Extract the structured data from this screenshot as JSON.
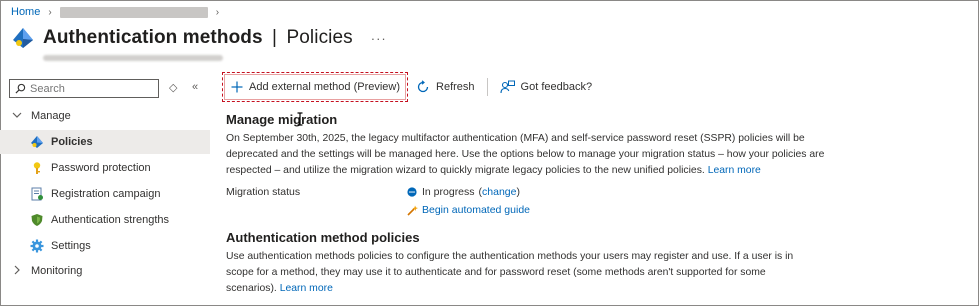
{
  "breadcrumb": {
    "home": "Home",
    "chevron": "›"
  },
  "header": {
    "title_main": "Authentication methods",
    "title_sep": "|",
    "title_sub": "Policies",
    "more": "···"
  },
  "sidebar": {
    "search_placeholder": "Search",
    "restore_icon": "◇",
    "collapse_icon": "«",
    "sections": [
      {
        "label": "Manage",
        "expanded": true
      },
      {
        "label": "Monitoring",
        "expanded": false
      }
    ],
    "items": [
      {
        "label": "Policies",
        "icon": "diamond-icon",
        "active": true
      },
      {
        "label": "Password protection",
        "icon": "key-icon",
        "active": false
      },
      {
        "label": "Registration campaign",
        "icon": "document-icon",
        "active": false
      },
      {
        "label": "Authentication strengths",
        "icon": "shield-icon",
        "active": false
      },
      {
        "label": "Settings",
        "icon": "gear-icon",
        "active": false
      }
    ]
  },
  "toolbar": {
    "add_label": "Add external method (Preview)",
    "refresh_label": "Refresh",
    "feedback_label": "Got feedback?"
  },
  "migration": {
    "heading": "Manage migration",
    "body": "On September 30th, 2025, the legacy multifactor authentication (MFA) and self-service password reset (SSPR) policies will be deprecated and the settings will be managed here. Use the options below to manage your migration status – how your policies are respected – and utilize the migration wizard to quickly migrate legacy policies to the new unified policies.",
    "learn_more": "Learn more",
    "status_label": "Migration status",
    "status_value": "In progress",
    "change_label": "change",
    "guide_label": "Begin automated guide"
  },
  "policies": {
    "heading": "Authentication method policies",
    "body": "Use authentication methods policies to configure the authentication methods your users may register and use. If a user is in scope for a method, they may use it to authenticate and for password reset (some methods aren't supported for some scenarios).",
    "learn_more": "Learn more"
  },
  "colors": {
    "link": "#0067b8",
    "active_bg": "#edebe9",
    "highlight_border": "#c50f1f"
  }
}
